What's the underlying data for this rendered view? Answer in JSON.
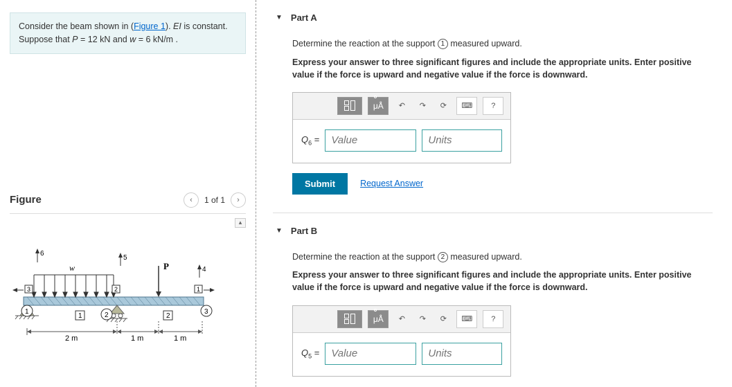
{
  "problem": {
    "intro_prefix": "Consider the beam shown in (",
    "figure_link": "Figure 1",
    "intro_suffix": "). ",
    "ei_note": "EI",
    "ei_suffix": " is constant. Suppose that ",
    "p_var": "P",
    "p_eq": " = 12  kN",
    "and": " and ",
    "w_var": "w",
    "w_eq": " = 6  kN/m ."
  },
  "figure": {
    "title": "Figure",
    "nav_label": "1 of 1"
  },
  "partA": {
    "title": "Part A",
    "instruction_prefix": "Determine the reaction at the support ",
    "support_num": "1",
    "instruction_suffix": " measured upward.",
    "note": "Express your answer to three significant figures and include the appropriate units. Enter positive value if the force is upward and negative value if the force is downward.",
    "var_label": "Q",
    "var_sub": "6",
    "eq": " = ",
    "value_placeholder": "Value",
    "units_placeholder": "Units",
    "submit_label": "Submit",
    "request_label": "Request Answer",
    "ua_label": "μÅ",
    "help_label": "?"
  },
  "partB": {
    "title": "Part B",
    "instruction_prefix": "Determine the reaction at the support ",
    "support_num": "2",
    "instruction_suffix": " measured upward.",
    "note": "Express your answer to three significant figures and include the appropriate units. Enter positive value if the force is upward and negative value if the force is downward.",
    "var_label": "Q",
    "var_sub": "5",
    "eq": " = ",
    "value_placeholder": "Value",
    "units_placeholder": "Units",
    "ua_label": "μÅ",
    "help_label": "?"
  },
  "beam_diagram": {
    "labels": {
      "n1": "1",
      "n2": "2",
      "n3": "3",
      "n4": "4",
      "n5": "5",
      "n6": "6",
      "elem1": "1",
      "elem2": "2",
      "w": "w",
      "P": "P"
    },
    "dims": {
      "span1": "2 m",
      "span2": "1 m",
      "span3": "1 m"
    }
  }
}
